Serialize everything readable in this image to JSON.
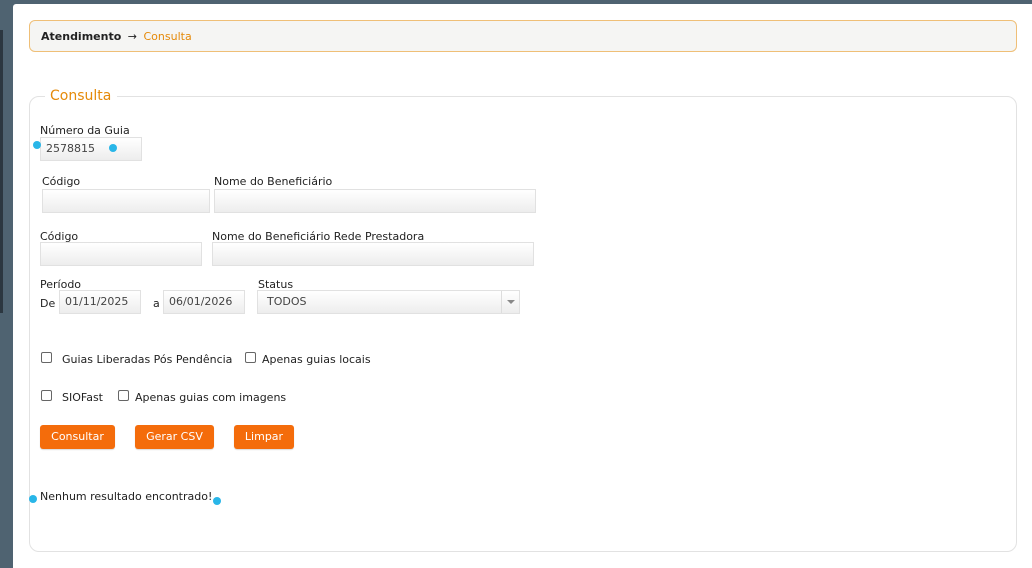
{
  "breadcrumb": {
    "root": "Atendimento",
    "separator": "→",
    "current": "Consulta"
  },
  "form": {
    "legend": "Consulta",
    "numero_guia": {
      "label": "Número da Guia",
      "value": "2578815"
    },
    "beneficiario": {
      "codigo_label": "Código",
      "codigo_value": "",
      "nome_label": "Nome do Beneficiário",
      "nome_value": ""
    },
    "rede_prestadora": {
      "codigo_label": "Código",
      "codigo_value": "",
      "nome_label": "Nome do Beneficiário Rede Prestadora",
      "nome_value": ""
    },
    "periodo": {
      "label": "Período",
      "de_label": "De",
      "de_value": "01/11/2025",
      "a_label": "a",
      "a_value": "06/01/2026"
    },
    "status": {
      "label": "Status",
      "selected": "TODOS"
    },
    "checkboxes": {
      "liberadas": "Guias Liberadas Pós Pendência",
      "locais": "Apenas guias locais",
      "siofast": "SIOFast",
      "imagens": "Apenas guias com imagens"
    },
    "buttons": {
      "consultar": "Consultar",
      "gerar_csv": "Gerar CSV",
      "limpar": "Limpar"
    },
    "result_message": "Nenhum resultado encontrado!"
  },
  "colors": {
    "accent": "#e58a0a",
    "button": "#f46c0b",
    "marker": "#29b6e8",
    "background": "#4f6371"
  }
}
